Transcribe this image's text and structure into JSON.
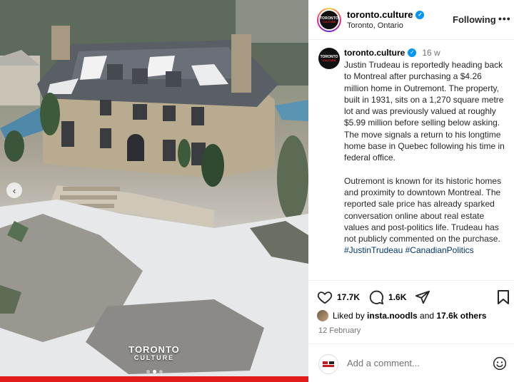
{
  "post": {
    "account": "toronto.culture",
    "location": "Toronto, Ontario",
    "follow_state": "Following",
    "more_label": "•••",
    "time_ago": "16 w",
    "caption_p1": "Justin Trudeau is reportedly heading back to Montreal after purchasing a $4.26 million home in Outremont. The property, built in 1931, sits on a 1,270 square metre lot and was previously valued at roughly $5.99 million before selling below asking. The move signals a return to his longtime home base in Quebec following his time in federal office.",
    "caption_p2": "Outremont is known for its historic homes and proximity to downtown Montreal. The reported sale price has already sparked conversation online about real estate values and post-politics life. Trudeau has not publicly commented on the purchase.",
    "hashtag1": "#JustinTrudeau",
    "hashtag2": "#CanadianPolitics",
    "like_count": "17.7K",
    "comment_count": "1.6K",
    "liked_by_prefix": "Liked by ",
    "liked_by_user": "insta.noodls",
    "liked_by_mid": " and ",
    "liked_by_others": "17.6k others",
    "date": "12 February",
    "comment_placeholder": "Add a comment...",
    "avatar_text_1": "TORONTO",
    "avatar_text_2": "CULTURE"
  },
  "media": {
    "watermark_line1": "TORONTO",
    "watermark_line2": "CULTURE",
    "prev_arrow": "‹",
    "slide_index": 2,
    "slide_count": 3
  },
  "colors": {
    "accent_blue": "#0095f6",
    "hashtag": "#00376b",
    "brand_red": "#e21b1b"
  },
  "icons": [
    "heart-icon",
    "comment-icon",
    "share-icon",
    "bookmark-icon",
    "emoji-icon",
    "verified-icon",
    "chevron-left-icon"
  ]
}
